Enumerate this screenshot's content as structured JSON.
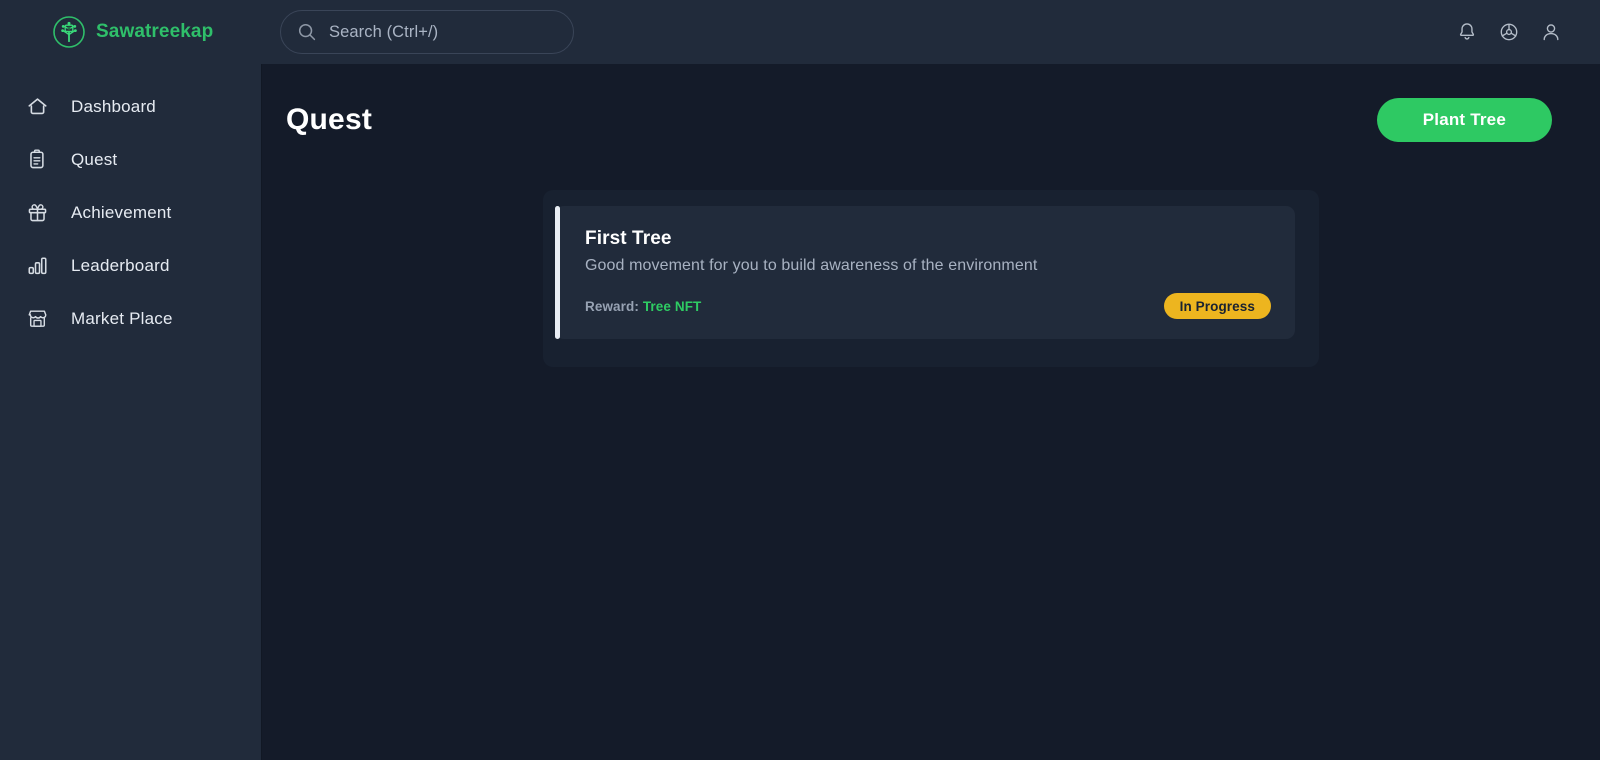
{
  "brand": {
    "name": "Sawatreekap",
    "logo_icon": "tree-circle-icon",
    "accent_color": "#2fbf6a"
  },
  "search": {
    "placeholder": "Search (Ctrl+/)",
    "value": "",
    "icon": "search-icon"
  },
  "topbar": {
    "actions": [
      {
        "name": "notifications",
        "icon": "bell-icon"
      },
      {
        "name": "settings",
        "icon": "gear-icon"
      },
      {
        "name": "account",
        "icon": "user-icon"
      }
    ]
  },
  "sidebar": {
    "items": [
      {
        "label": "Dashboard",
        "icon": "home-icon",
        "active": false
      },
      {
        "label": "Quest",
        "icon": "clipboard-icon",
        "active": false
      },
      {
        "label": "Achievement",
        "icon": "gift-icon",
        "active": false
      },
      {
        "label": "Leaderboard",
        "icon": "bar-chart-icon",
        "active": false
      },
      {
        "label": "Market Place",
        "icon": "store-icon",
        "active": false
      }
    ]
  },
  "page": {
    "title": "Quest",
    "primary_action": "Plant Tree",
    "primary_action_color": "#2ec963"
  },
  "quests": [
    {
      "title": "First Tree",
      "description": "Good movement for you to build awareness of the environment",
      "reward_label": "Reward:",
      "reward_value": "Tree NFT",
      "reward_color": "#2ecc63",
      "status": "In Progress",
      "status_color": "#edb51f"
    }
  ]
}
